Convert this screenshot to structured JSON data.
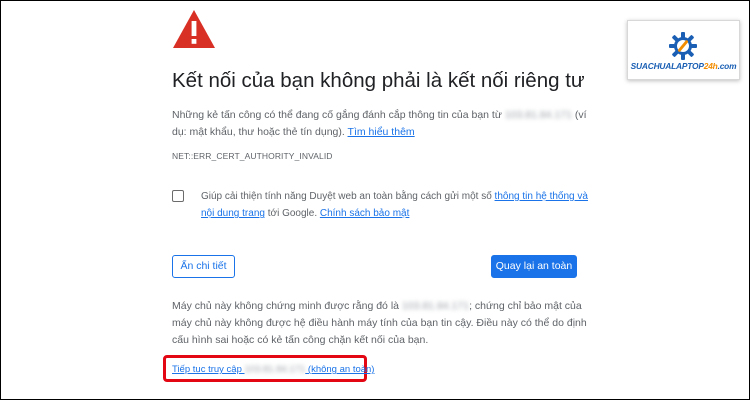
{
  "page": {
    "title": "Kết nối của bạn không phải là kết nối riêng tư",
    "intro_before": "Những kẻ tấn công có thể đang cố gắng đánh cắp thông tin của bạn từ ",
    "intro_host": "103.81.84.171",
    "intro_after": " (ví dụ: mật khẩu, thư hoặc thẻ tín dụng). ",
    "learn_more": "Tìm hiểu thêm",
    "error_code": "NET::ERR_CERT_AUTHORITY_INVALID"
  },
  "opt_in": {
    "checked": false,
    "text_before": "Giúp cải thiện tính năng Duyệt web an toàn bằng cách gửi một số ",
    "link_info": "thông tin hệ thống và nội dung trang",
    "text_middle": " tới Google. ",
    "link_privacy": "Chính sách bảo mật"
  },
  "buttons": {
    "hide_details": "Ẩn chi tiết",
    "back_to_safety": "Quay lại an toàn"
  },
  "details": {
    "text_before": "Máy chủ này không chứng minh được rằng đó là ",
    "host": "103.81.84.171",
    "text_after": "; chứng chỉ bảo mật của máy chủ này không được hệ điều hành máy tính của bạn tin cậy. Điều này có thể do định cấu hình sai hoặc có kẻ tấn công chặn kết nối của bạn.",
    "proceed_before": "Tiếp tục truy cập ",
    "proceed_host": "103.81.84.171",
    "proceed_after": " (không an toàn)"
  },
  "brand": {
    "name_part1": "SUACHUALAPTOP",
    "name_part2": "24h",
    "name_part3": ".com",
    "icon": "gear-wrench-icon"
  },
  "colors": {
    "accent_blue": "#1a73e8",
    "warning_red": "#d93025",
    "highlight_red": "#e30613",
    "brand_blue": "#1a5fb4",
    "brand_orange": "#f28c00"
  }
}
